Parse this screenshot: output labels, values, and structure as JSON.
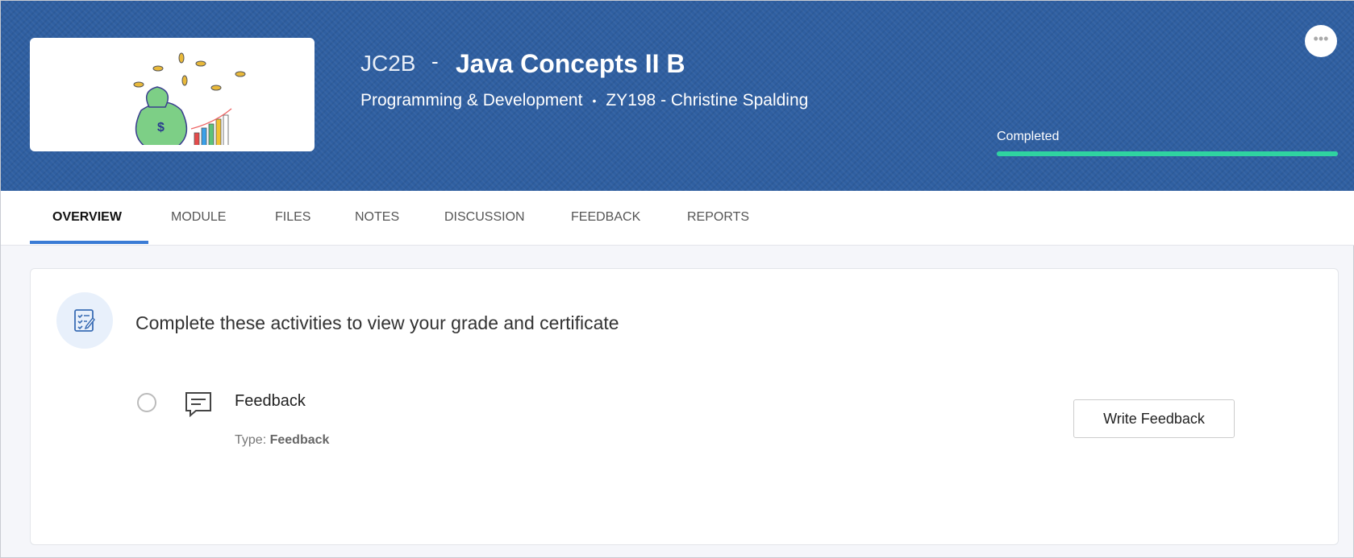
{
  "course": {
    "code": "JC2B",
    "separator": "-",
    "title": "Java Concepts II B",
    "category": "Programming & Development",
    "bullet": "•",
    "instructor": "ZY198 - Christine Spalding",
    "status": "Completed",
    "progress": 100,
    "more_label": "•••"
  },
  "tabs": [
    {
      "label": "OVERVIEW"
    },
    {
      "label": "MODULE"
    },
    {
      "label": "FILES"
    },
    {
      "label": "NOTES"
    },
    {
      "label": "DISCUSSION"
    },
    {
      "label": "FEEDBACK"
    },
    {
      "label": "REPORTS"
    }
  ],
  "overview": {
    "heading": "Complete these activities to view your grade and certificate",
    "activity": {
      "name": "Feedback",
      "type_label": "Type:",
      "type_value": "Feedback",
      "button": "Write Feedback"
    }
  },
  "colors": {
    "header": "#2f5fa1",
    "progress": "#2fd3a0",
    "tab_underline": "#3a7bd5"
  }
}
